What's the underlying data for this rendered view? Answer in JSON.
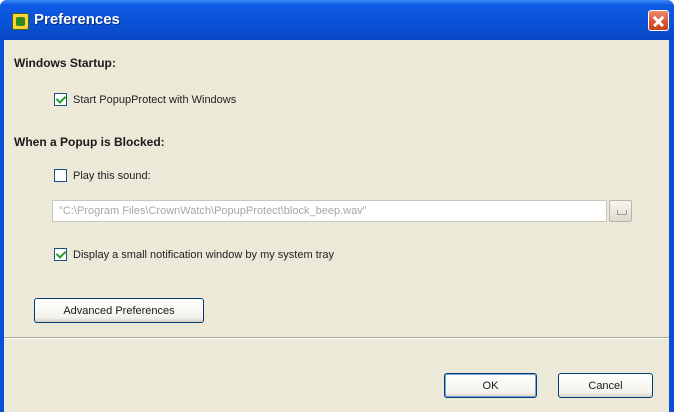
{
  "window": {
    "title": "Preferences"
  },
  "startup": {
    "heading": "Windows Startup:",
    "start_with_windows": {
      "label": "Start PopupProtect with Windows",
      "checked": true
    }
  },
  "blocked": {
    "heading": "When a Popup is Blocked:",
    "play_sound": {
      "label": "Play this sound:",
      "checked": false
    },
    "sound_path": "\"C:\\Program Files\\CrownWatch\\PopupProtect\\block_beep.wav\"",
    "notify": {
      "label": "Display a small notification window by my system tray",
      "checked": true
    }
  },
  "buttons": {
    "advanced": "Advanced Preferences",
    "ok": "OK",
    "cancel": "Cancel"
  },
  "icons": {
    "app": "app-icon",
    "close": "close-icon",
    "browse": "browse-icon"
  }
}
